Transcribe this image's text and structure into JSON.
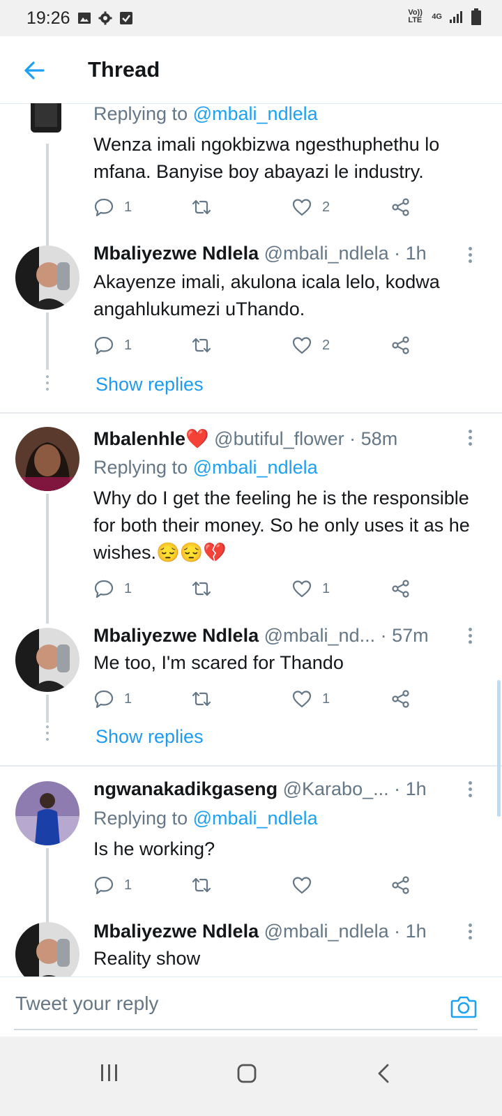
{
  "status_bar": {
    "time": "19:26",
    "network": "4G",
    "volte": "Vo)) LTE",
    "left_icons": [
      "image-icon",
      "gear-icon",
      "check-box-icon"
    ],
    "right_icons": [
      "signal-icon",
      "battery-icon"
    ]
  },
  "header": {
    "title": "Thread",
    "back_icon": "arrow-left-icon"
  },
  "colors": {
    "accent": "#1da1f2",
    "secondary_text": "#657786",
    "divider": "#e6ecf0",
    "heart": "#e0245e"
  },
  "tweets": [
    {
      "name": "",
      "handle": "",
      "time": "",
      "replying_prefix": "Replying to",
      "replying_handle": "@mbali_ndlela",
      "text": "Wenza imali ngokbizwa ngesthuphethu lo mfana. Banyise boy abayazi le industry.",
      "reply_count": "1",
      "like_count": "2"
    },
    {
      "name": "Mbaliyezwe Ndlela",
      "handle": "@mbali_ndlela",
      "time": "· 1h",
      "text": "Akayenze imali, akulona icala lelo, kodwa angahlukumezi uThando.",
      "reply_count": "1",
      "like_count": "2",
      "show_replies": "Show replies"
    },
    {
      "name": "Mbalenhle❤️",
      "handle": "@butiful_flower",
      "time": "· 58m",
      "replying_prefix": "Replying to",
      "replying_handle": "@mbali_ndlela",
      "text": "Why do I get the feeling he is the responsible for both their money. So he only uses it as he wishes.😔😔💔",
      "reply_count": "1",
      "like_count": "1"
    },
    {
      "name": "Mbaliyezwe Ndlela",
      "handle": "@mbali_nd...",
      "time": "· 57m",
      "text": "Me too, I'm scared for Thando",
      "reply_count": "1",
      "like_count": "1",
      "show_replies": "Show replies"
    },
    {
      "name": "ngwanakadikgaseng",
      "handle": "@Karabo_...",
      "time": "· 1h",
      "replying_prefix": "Replying to",
      "replying_handle": "@mbali_ndlela",
      "text": "Is he working?",
      "reply_count": "1",
      "like_count": ""
    },
    {
      "name": "Mbaliyezwe Ndlela",
      "handle": "@mbali_ndlela",
      "time": "· 1h",
      "text": "Reality show"
    }
  ],
  "compose": {
    "placeholder": "Tweet your reply",
    "camera_icon": "camera-icon"
  },
  "nav_bar": {
    "buttons": [
      "recent-apps-icon",
      "home-icon",
      "back-chevron-icon"
    ]
  }
}
